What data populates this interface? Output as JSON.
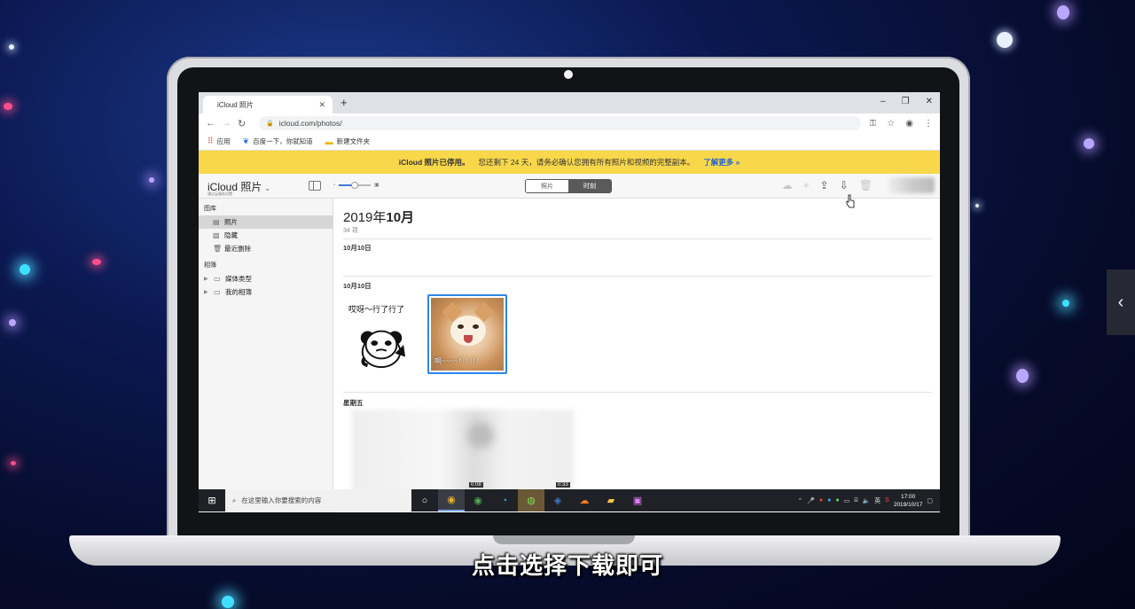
{
  "browser": {
    "tab_title": "iCloud 照片",
    "new_tab": "+",
    "url": "icloud.com/photos/",
    "window_controls": [
      "–",
      "❐",
      "✕"
    ],
    "bookmarks": [
      "应用",
      "百度一下，你就知道",
      "新建文件夹"
    ]
  },
  "banner": {
    "strong": "iCloud 照片已停用。",
    "text": "您还剩下 24 天，请务必确认您拥有所有照片和视频的完整副本。",
    "link": "了解更多 »"
  },
  "toolbar": {
    "app_title": "iCloud 照片",
    "app_subtitle": "通过云服务设置",
    "zoom_level": 0.5,
    "segment_photos": "照片",
    "segment_moments": "时刻"
  },
  "sidebar": {
    "library_header": "图库",
    "library_items": [
      {
        "label": "照片",
        "icon": "photos-icon"
      },
      {
        "label": "隐藏",
        "icon": "hidden-icon"
      },
      {
        "label": "最近删除",
        "icon": "trash-icon"
      }
    ],
    "albums_header": "相簿",
    "album_items": [
      {
        "label": "媒体类型",
        "icon": "folder-icon"
      },
      {
        "label": "我的相簿",
        "icon": "folder-icon"
      }
    ]
  },
  "main": {
    "month_year": "2019年",
    "month": "10月",
    "count": "34 项",
    "day1": "10月10日",
    "day2": "10月10日",
    "meme1_caption": "哎呀～行了行了",
    "meme2_caption": "啊~~~~！！！",
    "day3": "星期五",
    "video_durations": [
      "0:08",
      "0:33"
    ]
  },
  "taskbar": {
    "search_placeholder": "在这里输入你要搜索的内容",
    "ime": "英",
    "time": "17:00",
    "date": "2019/10/17"
  },
  "subtitle": "点击选择下载即可"
}
